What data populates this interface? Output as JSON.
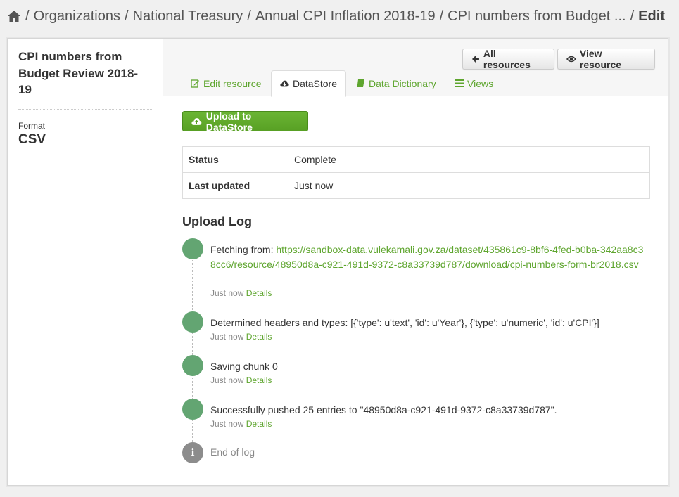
{
  "breadcrumb": {
    "items": [
      "Organizations",
      "National Treasury",
      "Annual CPI Inflation 2018-19",
      "CPI numbers from Budget ..."
    ],
    "current": "Edit"
  },
  "sidebar": {
    "title": "CPI numbers from Budget Review 2018-19",
    "format_label": "Format",
    "format_value": "CSV"
  },
  "header": {
    "all_resources": "All resources",
    "view_resource": "View resource"
  },
  "tabs": [
    {
      "label": "Edit resource",
      "icon": "edit-icon"
    },
    {
      "label": "DataStore",
      "icon": "cloud-icon",
      "active": true
    },
    {
      "label": "Data Dictionary",
      "icon": "book-icon"
    },
    {
      "label": "Views",
      "icon": "list-icon"
    }
  ],
  "upload_button": "Upload to DataStore",
  "status_table": [
    {
      "key": "Status",
      "value": "Complete"
    },
    {
      "key": "Last updated",
      "value": "Just now"
    }
  ],
  "log": {
    "title": "Upload Log",
    "entries": [
      {
        "prefix": "Fetching from: ",
        "link": "https://sandbox-data.vulekamali.gov.za/dataset/435861c9-8bf6-4fed-b0ba-342aa8c38cc6/resource/48950d8a-c921-491d-9372-c8a33739d787/download/cpi-numbers-form-br2018.csv",
        "time": "Just now",
        "details": "Details"
      },
      {
        "text": "Determined headers and types: [{'type': u'text', 'id': u'Year'}, {'type': u'numeric', 'id': u'CPI'}]",
        "time": "Just now",
        "details": "Details"
      },
      {
        "text": "Saving chunk 0",
        "time": "Just now",
        "details": "Details"
      },
      {
        "text": "Successfully pushed 25 entries to \"48950d8a-c921-491d-9372-c8a33739d787\".",
        "time": "Just now",
        "details": "Details"
      }
    ],
    "end": "End of log"
  },
  "colors": {
    "accent": "#5ea52e",
    "dot": "#63a572",
    "button_green": "#58a024"
  }
}
